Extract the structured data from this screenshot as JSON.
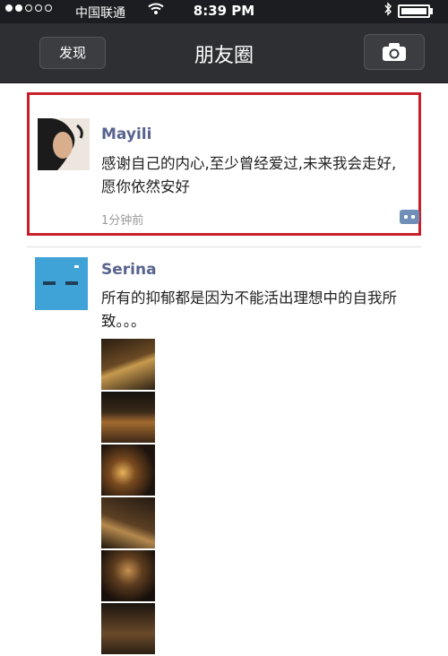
{
  "status_bar": {
    "carrier": "中国联通",
    "time": "8:39 PM"
  },
  "nav": {
    "back_label": "发现",
    "title": "朋友圈",
    "camera_icon": "camera-icon"
  },
  "posts": [
    {
      "name": "Mayili",
      "text": "感谢自己的内心,至少曾经爱过,未来我会走好,愿你依然安好",
      "time": "1分钟前",
      "highlight_color": "#c8202a"
    },
    {
      "name": "Serina",
      "text": "所有的抑郁都是因为不能活出理想中的自我所致。。。"
    }
  ],
  "colors": {
    "name_color": "#58638f",
    "nav_bg": "#2d2f33",
    "status_bg": "#1c1d20"
  }
}
